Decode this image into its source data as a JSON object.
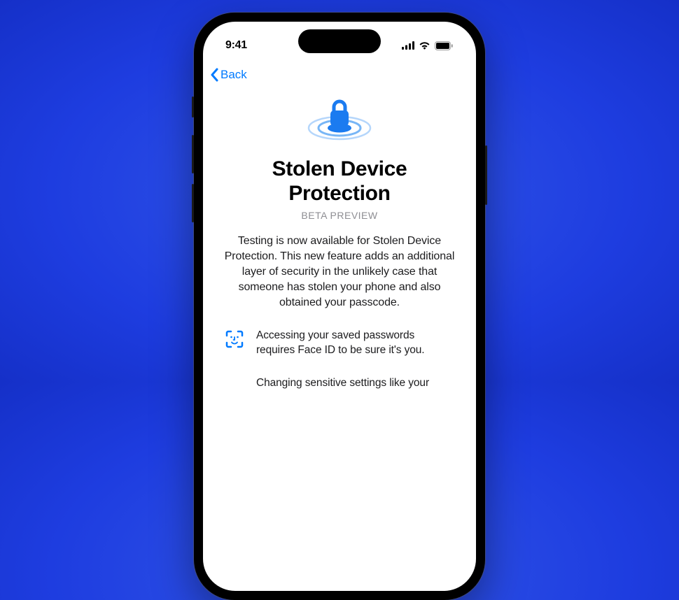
{
  "status": {
    "time": "9:41"
  },
  "nav": {
    "back_label": "Back"
  },
  "page": {
    "title": "Stolen Device Protection",
    "subtitle": "BETA PREVIEW",
    "body": "Testing is now available for Stolen Device Protection. This new feature adds an additional layer of security in the unlikely case that someone has stolen your phone and also obtained your passcode."
  },
  "features": [
    {
      "text": "Accessing your saved passwords requires Face ID to be sure it's you."
    },
    {
      "text": "Changing sensitive settings like your"
    }
  ]
}
